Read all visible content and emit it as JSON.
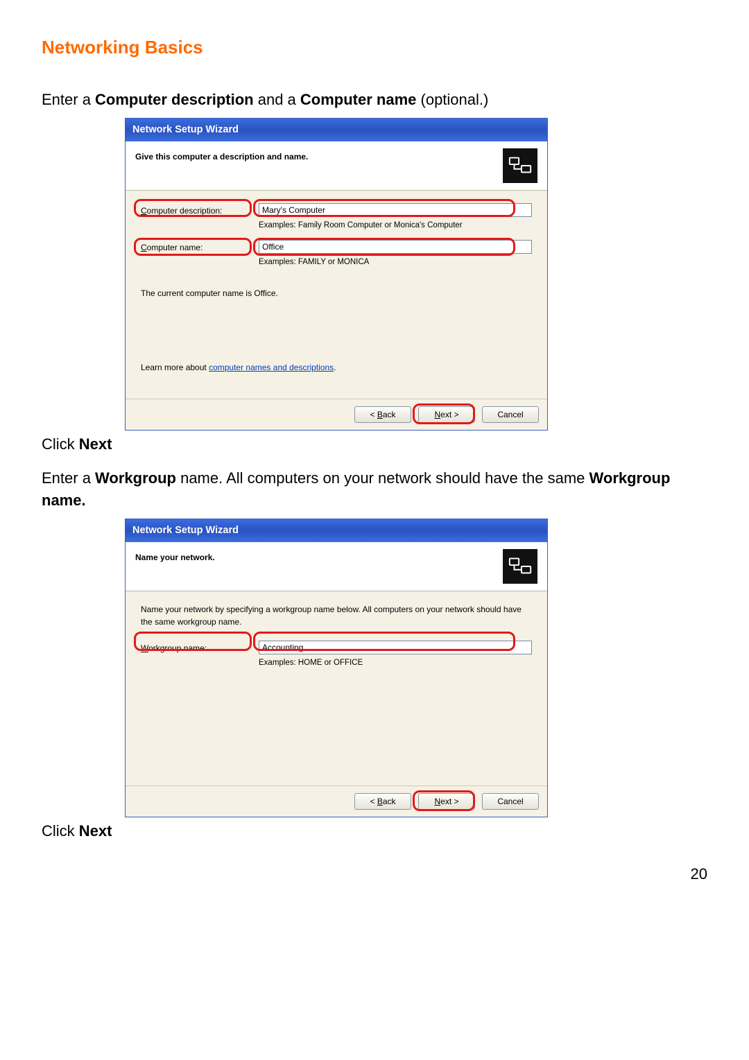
{
  "page": {
    "title": "Networking Basics",
    "page_number": "20",
    "instr1_a": "Enter a ",
    "instr1_b": "Computer description",
    "instr1_c": " and a ",
    "instr1_d": "Computer name",
    "instr1_e": " (optional.)",
    "click_a": "Click ",
    "click_b": "Next",
    "instr2_a": "Enter a ",
    "instr2_b": "Workgroup",
    "instr2_c": " name.  All computers on your network should have the same ",
    "instr2_d": "Workgroup name."
  },
  "wiz1": {
    "title": "Network Setup Wizard",
    "banner": "Give this computer a description and name.",
    "desc_label": "Computer description:",
    "desc_value": "Mary's Computer",
    "desc_example": "Examples: Family Room Computer or Monica's Computer",
    "name_label": "Computer name:",
    "name_value": "Office",
    "name_example": "Examples: FAMILY or MONICA",
    "current": "The current computer name is Office.",
    "learn_pre": "Learn more about ",
    "learn_link": "computer names and descriptions",
    "learn_post": ".",
    "back": "< Back",
    "next": "Next >",
    "cancel": "Cancel"
  },
  "wiz2": {
    "title": "Network Setup Wizard",
    "banner": "Name your network.",
    "intro": "Name your network by specifying a workgroup name below. All computers on your network should have the same workgroup name.",
    "wg_label": "Workgroup name:",
    "wg_value": "Accounting",
    "wg_example": "Examples: HOME or OFFICE",
    "back": "< Back",
    "next": "Next >",
    "cancel": "Cancel"
  }
}
